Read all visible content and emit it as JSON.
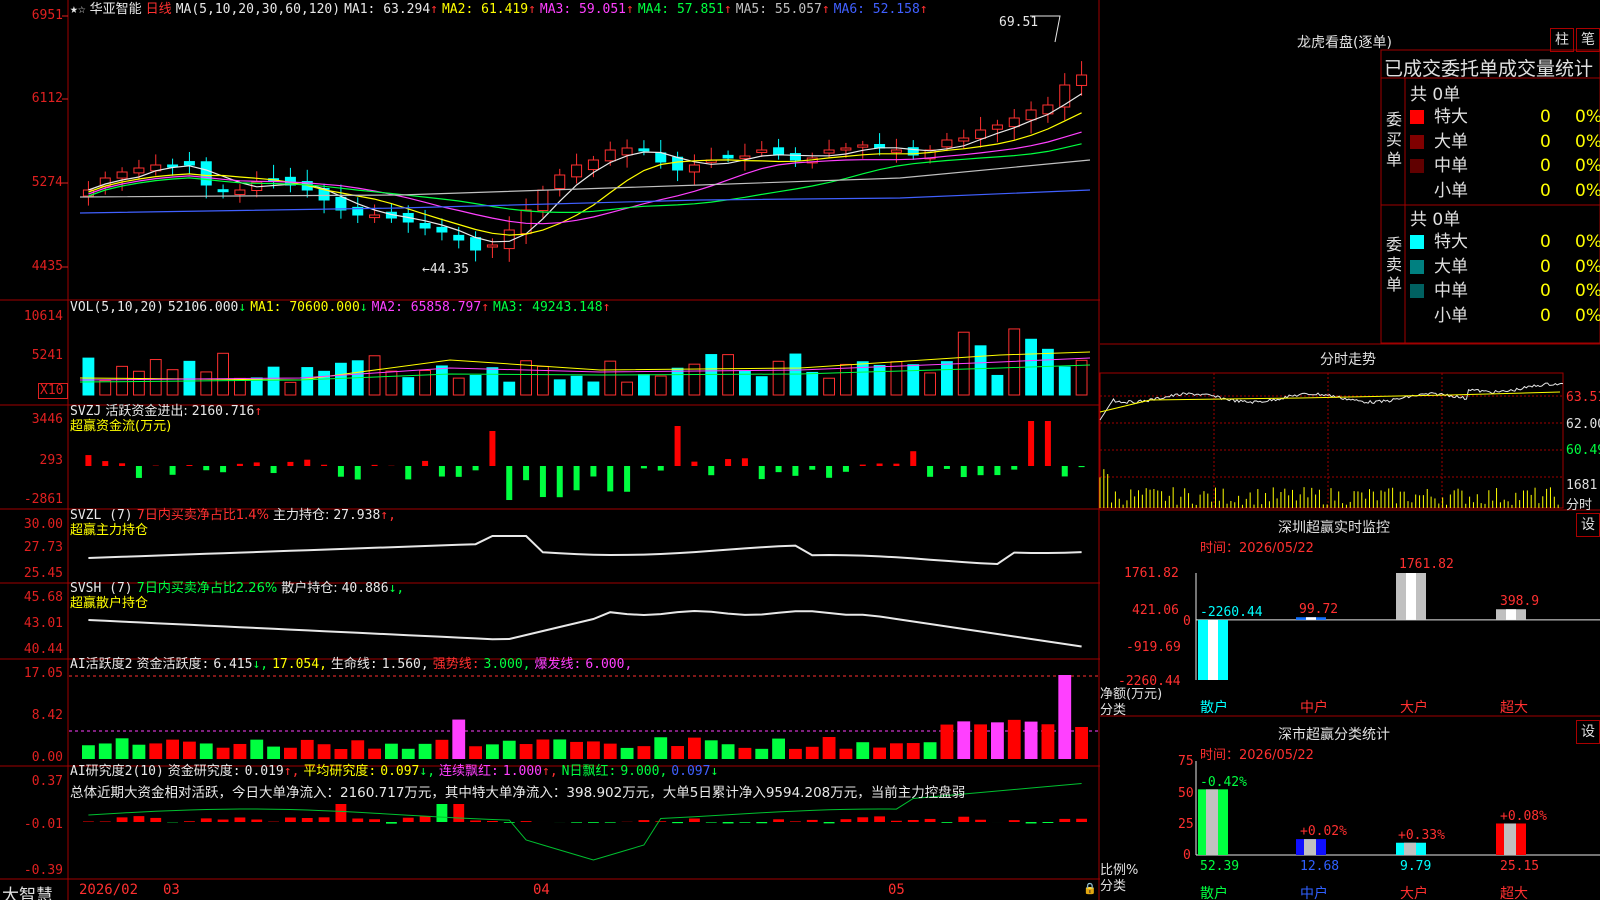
{
  "app": {
    "logo": "大智慧"
  },
  "stock": {
    "name": "华亚智能",
    "period": "日线",
    "flags": "★☆"
  },
  "main_panel": {
    "ma_label": "MA(5,10,20,30,60,120)",
    "ma": [
      {
        "name": "MA1:",
        "value": "63.294",
        "arrow": "↑",
        "color": "#e8e8e8"
      },
      {
        "name": "MA2:",
        "value": "61.419",
        "arrow": "↑",
        "color": "#ffff00"
      },
      {
        "name": "MA3:",
        "value": "59.051",
        "arrow": "↑",
        "color": "#ff40ff"
      },
      {
        "name": "MA4:",
        "value": "57.851",
        "arrow": "↑",
        "color": "#00ff40"
      },
      {
        "name": "MA5:",
        "value": "55.057",
        "arrow": "↑",
        "color": "#c0c0c0"
      },
      {
        "name": "MA6:",
        "value": "52.158",
        "arrow": "↑",
        "color": "#4060ff"
      }
    ],
    "y_ticks": [
      "6951",
      "6112",
      "5274",
      "4435"
    ],
    "high_label": "69.51",
    "low_label": "44.35"
  },
  "vol_panel": {
    "label": "VOL(5,10,20)",
    "value": "52106.000",
    "value_arrow": "↓",
    "ma": [
      {
        "name": "MA1:",
        "value": "70600.000",
        "arrow": "↓",
        "color": "#ffff00"
      },
      {
        "name": "MA2:",
        "value": "65858.797",
        "arrow": "↑",
        "color": "#ff40ff"
      },
      {
        "name": "MA3:",
        "value": "49243.148",
        "arrow": "↑",
        "color": "#00ff40"
      }
    ],
    "y_ticks": [
      "10614",
      "5241"
    ],
    "unit": "X10"
  },
  "svzj_panel": {
    "label": "SVZJ",
    "desc": "活跃资金进出:",
    "value": "2160.716",
    "arrow": "↑",
    "subtitle": "超赢资金流(万元)",
    "y_ticks": [
      "3446",
      "293",
      "-2861"
    ]
  },
  "svzl_panel": {
    "label": "SVZL (7)",
    "desc": "7日内买卖净占比1.4%",
    "hold_label": "主力持仓:",
    "hold_value": "27.938",
    "arrow": "↑,",
    "subtitle": "超赢主力持仓",
    "y_ticks": [
      "30.00",
      "27.73",
      "25.45"
    ]
  },
  "svsh_panel": {
    "label": "SVSH (7)",
    "desc": "7日内买卖净占比2.26%",
    "hold_label": "散户持仓:",
    "hold_value": "40.886",
    "arrow": "↓,",
    "subtitle": "超赢散户持仓",
    "y_ticks": [
      "45.68",
      "43.01",
      "40.44"
    ]
  },
  "ai_active_panel": {
    "label": "AI活跃度2",
    "act_label": "资金活跃度:",
    "act_value": "6.415",
    "act_arrow": "↓,",
    "v2": "17.054,",
    "life_label": "生命线:",
    "life_value": "1.560,",
    "strong_label": "强势线:",
    "strong_value": "3.000,",
    "burst_label": "爆发线:",
    "burst_value": "6.000,",
    "y_ticks": [
      "17.05",
      "8.42",
      "0.00"
    ]
  },
  "ai_research_panel": {
    "label": "AI研究度2(10)",
    "r_label": "资金研究度:",
    "r_value": "0.019",
    "r_arrow": "↑,",
    "avg_label": "平均研究度:",
    "avg_value": "0.097",
    "avg_arrow": "↓,",
    "lian_label": "连续飘红:",
    "lian_value": "1.000",
    "lian_arrow": "↑,",
    "n_label": "N日飘红:",
    "n_value": "9.000,",
    "n2": "0.097",
    "n2_arrow": "↓",
    "summary": "总体近期大资金相对活跃，今日大单净流入：2160.717万元，其中特大单净流入：398.902万元，大单5日累计净入9594.208万元，当前主力控盘弱",
    "y_ticks": [
      "0.37",
      "-0.01",
      "-0.39"
    ]
  },
  "time_axis": {
    "labels": [
      "2026/02",
      "03",
      "04",
      "05"
    ]
  },
  "dragon_tiger": {
    "title": "龙虎看盘(逐单)",
    "btn1": "柱",
    "btn2": "笔",
    "header": "已成交委托单成交量统计",
    "buy": {
      "side_label": "委买单",
      "total": "共 0单",
      "rows": [
        {
          "label": "特大",
          "count": "0",
          "pct": "0%",
          "color": "#ff0000"
        },
        {
          "label": "大单",
          "count": "0",
          "pct": "0%",
          "color": "#800000"
        },
        {
          "label": "中单",
          "count": "0",
          "pct": "0%",
          "color": "#600000"
        },
        {
          "label": "小单",
          "count": "0",
          "pct": "0%",
          "color": "#000000"
        }
      ]
    },
    "sell": {
      "side_label": "委卖单",
      "total": "共 0单",
      "rows": [
        {
          "label": "特大",
          "count": "0",
          "pct": "0%",
          "color": "#00ffff"
        },
        {
          "label": "大单",
          "count": "0",
          "pct": "0%",
          "color": "#008080"
        },
        {
          "label": "中单",
          "count": "0",
          "pct": "0%",
          "color": "#006060"
        },
        {
          "label": "小单",
          "count": "0",
          "pct": "0%",
          "color": "#000000"
        }
      ]
    }
  },
  "intraday": {
    "title": "分时走势",
    "y_ticks": [
      "63.51",
      "62.00",
      "60.49"
    ],
    "vol_tick": "1681",
    "vol_unit": "分时"
  },
  "sz_monitor": {
    "title": "深圳超赢实时监控",
    "btn": "设",
    "time_label": "时间：2026/05/22",
    "y_ticks": [
      "1761.82",
      "421.06",
      "0",
      "-919.69",
      "-2260.44"
    ],
    "y_axis_label": "净额(万元)",
    "x_axis_label": "分类",
    "categories": [
      "散户",
      "中户",
      "大户",
      "超大"
    ],
    "bar_labels": [
      "-2260.44",
      "99.72",
      "1761.82",
      "398.9"
    ]
  },
  "sz_classify": {
    "title": "深市超赢分类统计",
    "btn": "设",
    "time_label": "时间：2026/05/22",
    "y_ticks": [
      "75",
      "50",
      "25",
      "0"
    ],
    "y_axis_label": "比例%",
    "x_axis_label": "分类",
    "categories": [
      "散户",
      "中户",
      "大户",
      "超大"
    ],
    "top_labels": [
      "-0.42%",
      "+0.02%",
      "+0.33%",
      "+0.08%"
    ],
    "bottom_labels": [
      "52.39",
      "12.68",
      "9.79",
      "25.15"
    ]
  },
  "chart_data": [
    {
      "type": "bar",
      "title": "深圳超赢实时监控",
      "categories": [
        "散户",
        "中户",
        "大户",
        "超大"
      ],
      "values": [
        -2260.44,
        99.72,
        1761.82,
        398.9
      ],
      "ylabel": "净额(万元)",
      "ylim": [
        -2260.44,
        1761.82
      ]
    },
    {
      "type": "bar",
      "title": "深市超赢分类统计",
      "categories": [
        "散户",
        "中户",
        "大户",
        "超大"
      ],
      "values": [
        52.39,
        12.68,
        9.79,
        25.15
      ],
      "ylabel": "比例%",
      "ylim": [
        0,
        75
      ]
    }
  ]
}
